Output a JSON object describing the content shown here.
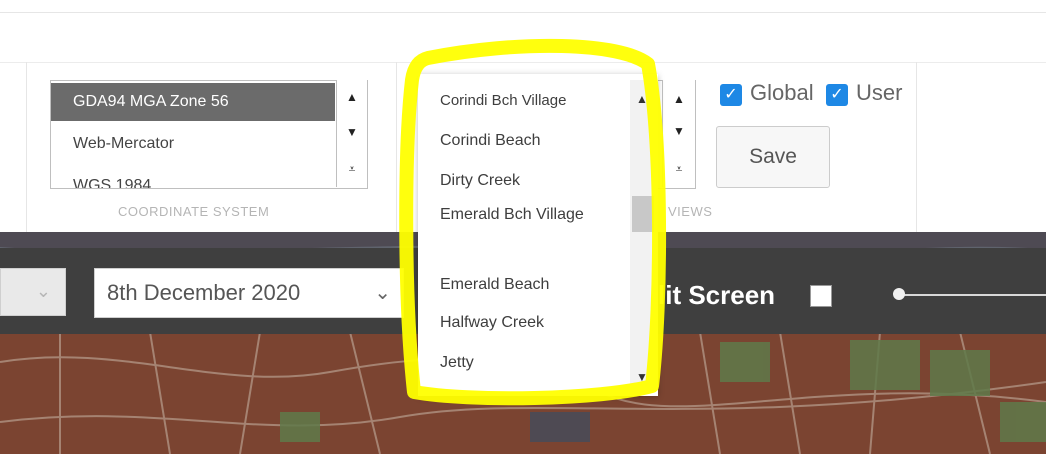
{
  "coordinate_system": {
    "items": [
      "GDA94 MGA Zone 56",
      "Web-Mercator",
      "WGS 1984"
    ],
    "selected_index": 0,
    "caption": "COORDINATE SYSTEM",
    "spin_up_icon": "triangle-up",
    "spin_down_icon": "triangle-down",
    "spin_expand_icon": "expand-down"
  },
  "views": {
    "caption": "VIEWS",
    "global_label": "Global",
    "user_label": "User",
    "global_checked": true,
    "user_checked": true,
    "save_label": "Save",
    "dropdown_items": [
      "Corindi Bch Village",
      "Corindi Beach",
      "Dirty Creek",
      "Emerald Bch Village",
      "Emerald Beach",
      "Halfway Creek",
      "Jetty"
    ]
  },
  "map_toolbar": {
    "date_value": "8th December 2020",
    "split_screen_label": "lit Screen",
    "split_screen_checked": false
  },
  "colors": {
    "toolbar_bg": "#3f3f3f",
    "selected_bg": "#6b6b6b",
    "checkbox_blue": "#1e88e5",
    "highlight_yellow": "#ffff00"
  }
}
